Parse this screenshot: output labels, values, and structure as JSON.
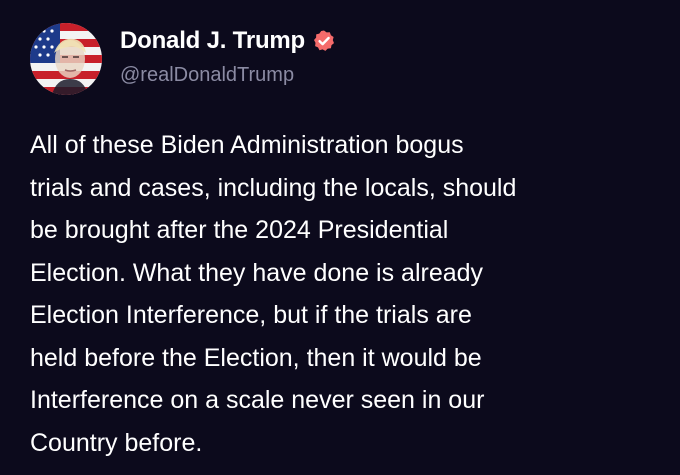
{
  "author": {
    "display_name": "Donald J. Trump",
    "handle": "@realDonaldTrump",
    "verified_icon": "verified-badge-icon",
    "avatar_icon": "avatar"
  },
  "post": {
    "lines": [
      "All of these Biden Administration bogus",
      "trials and cases, including the locals, should",
      "be brought after the 2024 Presidential",
      "Election. What they have done is already",
      "Election Interference, but if the trials are",
      "held before the Election, then it would be",
      "Interference on a scale never seen in our",
      "Country before."
    ]
  },
  "colors": {
    "background": "#0c0a1c",
    "text": "#ffffff",
    "handle": "#8b8ba3",
    "verified_badge": "#f56b6b"
  }
}
